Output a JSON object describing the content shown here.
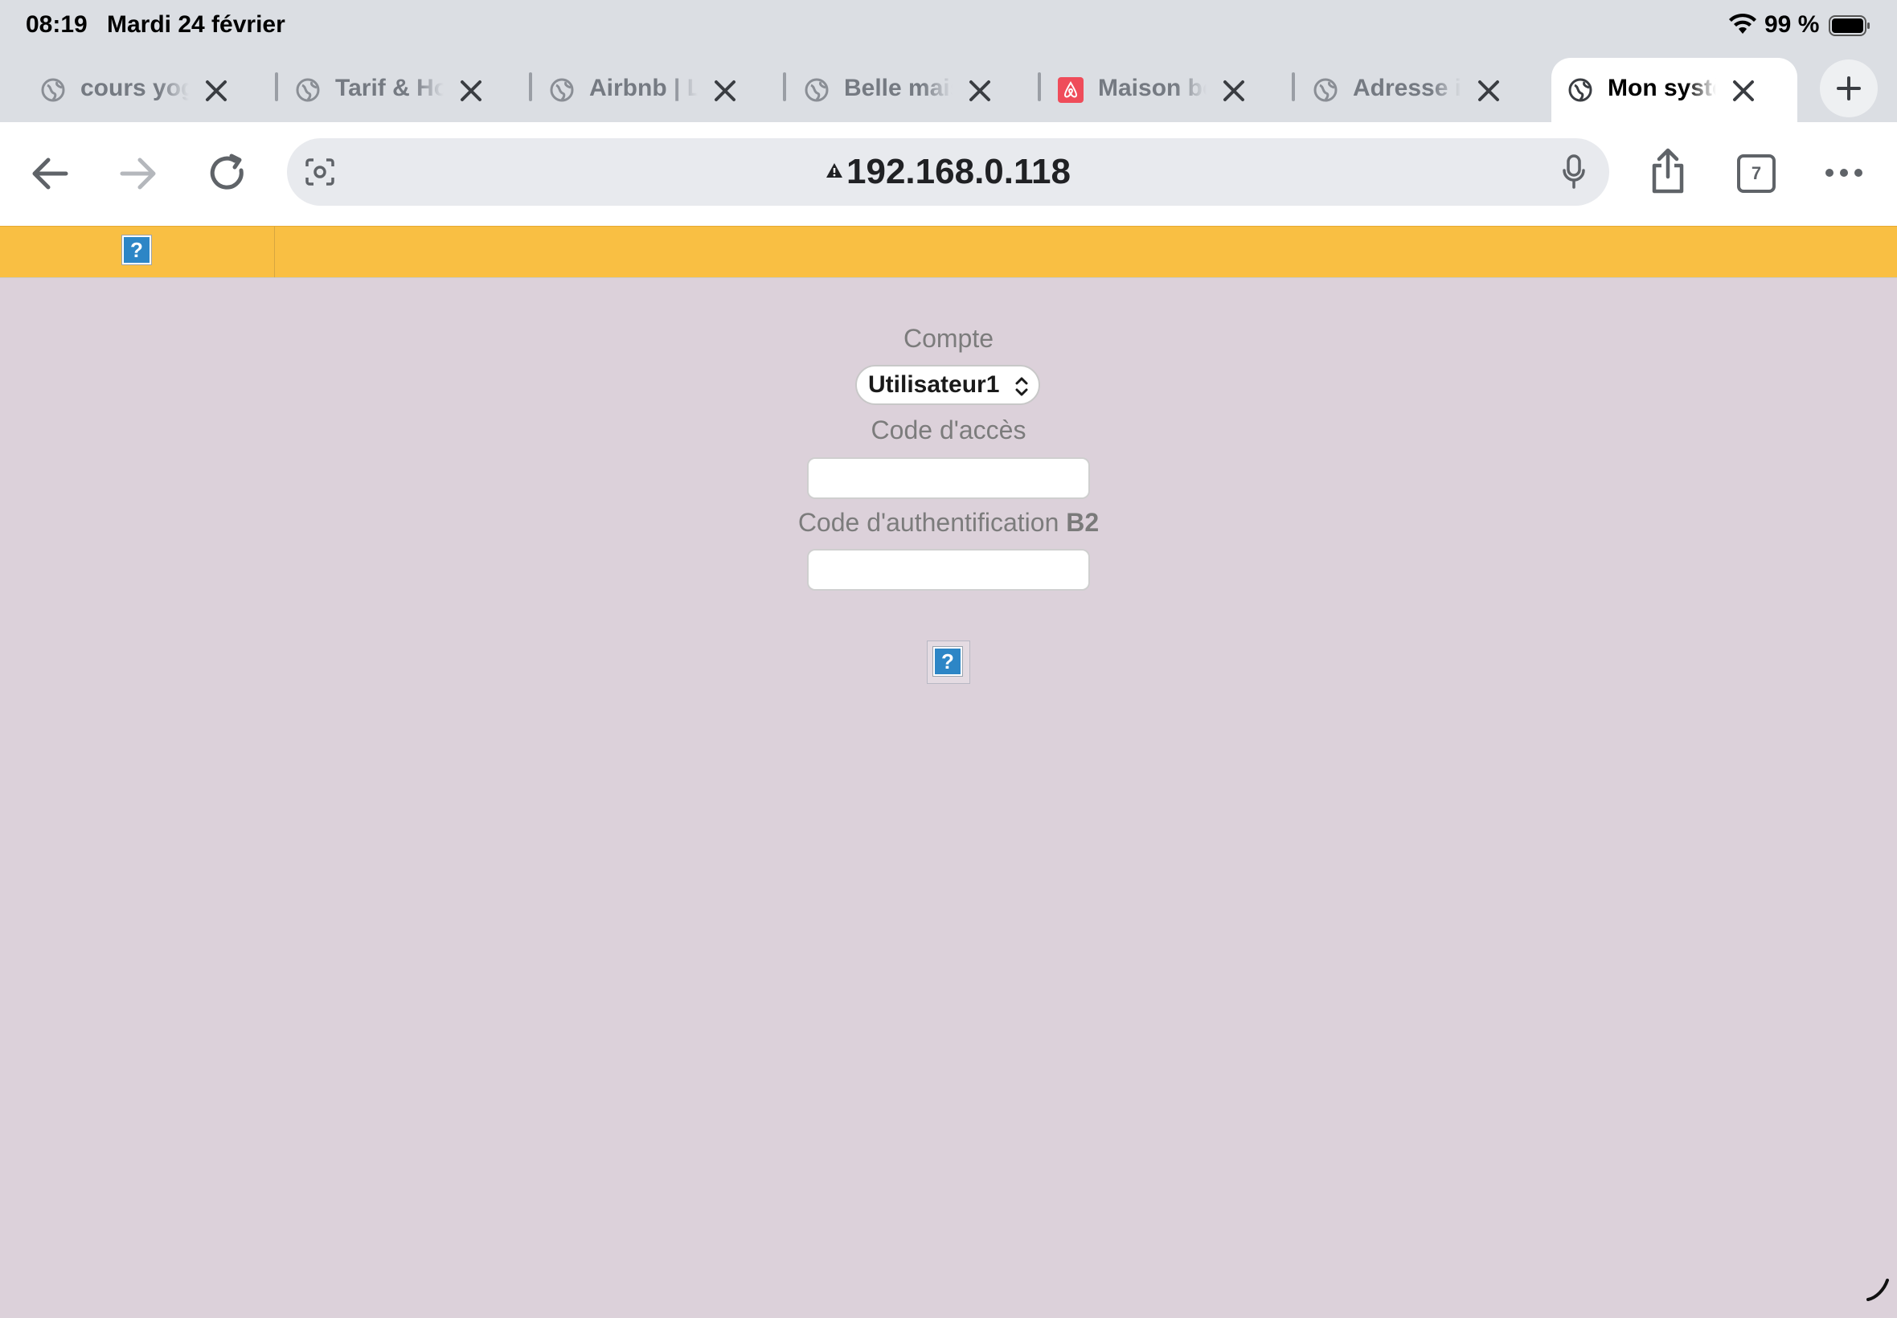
{
  "status_bar": {
    "time": "08:19",
    "date": "Mardi 24 février",
    "battery_percent": "99 %"
  },
  "tabs": [
    {
      "title": "cours yoga",
      "favicon": "globe-icon"
    },
    {
      "title": "Tarif & Hora",
      "favicon": "globe-icon"
    },
    {
      "title": "Airbnb | Loc",
      "favicon": "globe-icon"
    },
    {
      "title": "Belle maiso",
      "favicon": "globe-icon"
    },
    {
      "title": "Maison bord",
      "favicon": "airbnb-icon"
    },
    {
      "title": "Adresse ip d",
      "favicon": "globe-icon"
    },
    {
      "title": "Mon systèm",
      "favicon": "globe-icon",
      "active": true
    }
  ],
  "toolbar": {
    "address": "192.168.0.118",
    "tab_count": "7"
  },
  "form": {
    "account_label": "Compte",
    "account_value": "Utilisateur1",
    "access_code_label": "Code d'accès",
    "access_code_value": "",
    "auth_code_label": "Code d'authentification",
    "auth_code_suffix": "B2",
    "auth_code_value": ""
  },
  "placeholders": {
    "broken_image_glyph": "?"
  },
  "colors": {
    "band": "#f9bf43",
    "page_background": "#dcd1da",
    "broken_image": "#2d86c6"
  }
}
